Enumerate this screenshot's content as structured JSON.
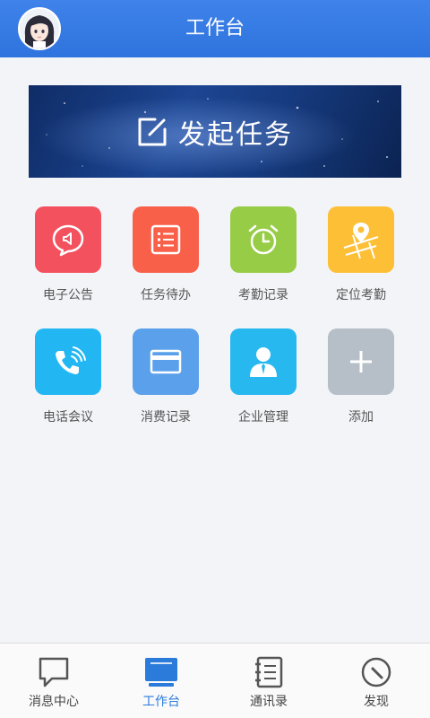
{
  "header": {
    "title": "工作台"
  },
  "banner": {
    "label": "发起任务"
  },
  "grid": {
    "items": [
      {
        "label": "电子公告",
        "icon": "megaphone-icon",
        "color": "#f4515f"
      },
      {
        "label": "任务待办",
        "icon": "list-icon",
        "color": "#f9604a"
      },
      {
        "label": "考勤记录",
        "icon": "alarm-clock-icon",
        "color": "#97cc47"
      },
      {
        "label": "定位考勤",
        "icon": "map-pin-icon",
        "color": "#fdbf36"
      },
      {
        "label": "电话会议",
        "icon": "phone-icon",
        "color": "#22b7f2"
      },
      {
        "label": "消费记录",
        "icon": "card-icon",
        "color": "#5ba0ea"
      },
      {
        "label": "企业管理",
        "icon": "user-icon",
        "color": "#27b8f0"
      },
      {
        "label": "添加",
        "icon": "plus-icon",
        "color": "#b6bfc8"
      }
    ]
  },
  "bottom_nav": {
    "items": [
      {
        "label": "消息中心",
        "icon": "chat-bubble-icon",
        "active": false
      },
      {
        "label": "工作台",
        "icon": "monitor-icon",
        "active": true
      },
      {
        "label": "通讯录",
        "icon": "contacts-book-icon",
        "active": false
      },
      {
        "label": "发现",
        "icon": "compass-icon",
        "active": false
      }
    ]
  },
  "colors": {
    "header": "#3079e4",
    "nav_active": "#2b7bdb",
    "background": "#f3f4f8"
  }
}
